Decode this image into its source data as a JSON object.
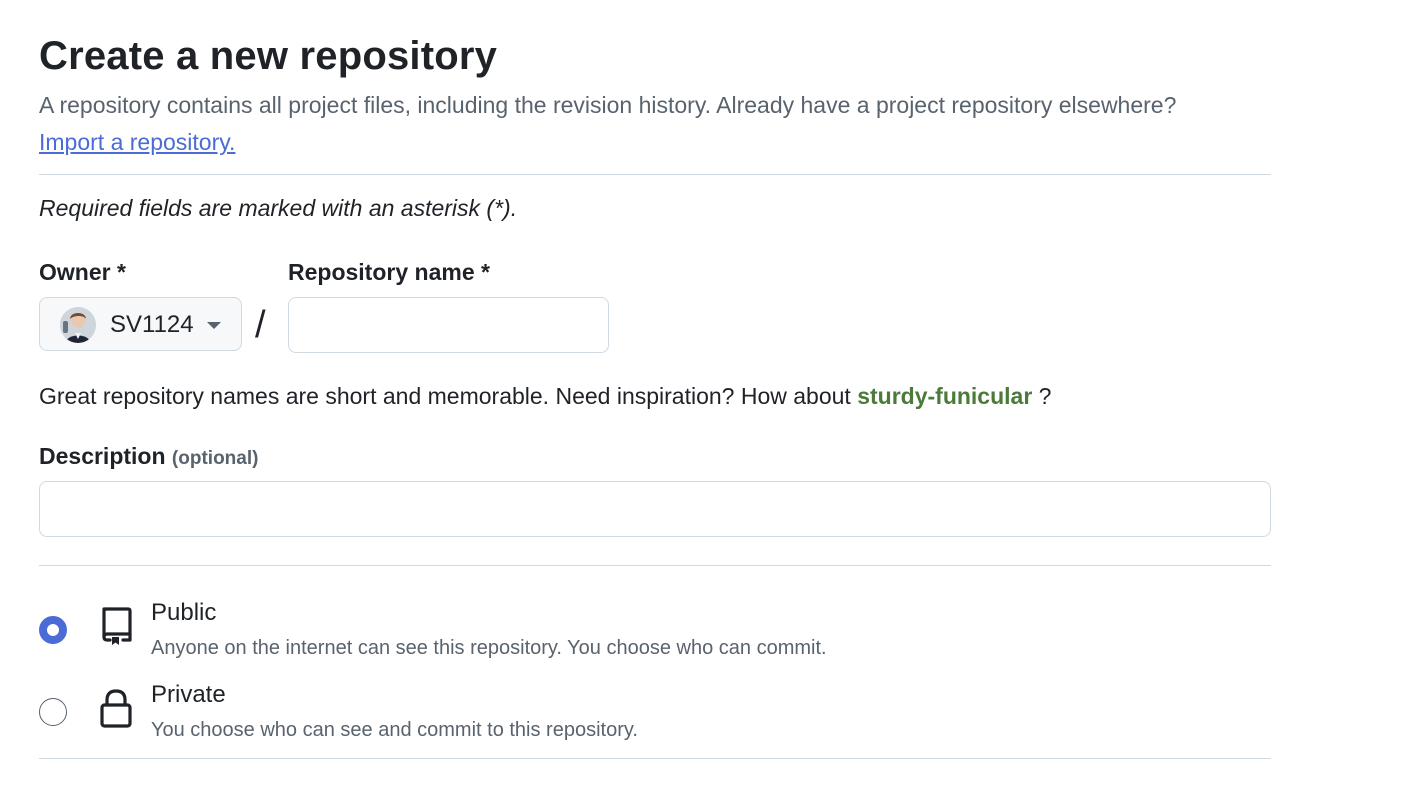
{
  "header": {
    "title": "Create a new repository",
    "subtitle": "A repository contains all project files, including the revision history. Already have a project repository elsewhere?",
    "import_link": "Import a repository."
  },
  "form": {
    "required_note": "Required fields are marked with an asterisk (*).",
    "owner": {
      "label": "Owner *",
      "value": "SV1124"
    },
    "separator": "/",
    "repo_name": {
      "label": "Repository name *",
      "value": "",
      "placeholder": ""
    },
    "name_help": {
      "prefix": "Great repository names are short and memorable. Need inspiration? How about",
      "suggestion": "sturdy-funicular",
      "suffix": "?"
    },
    "description": {
      "label": "Description",
      "optional_tag": "(optional)",
      "value": "",
      "placeholder": ""
    }
  },
  "visibility": {
    "selected": "public",
    "options": [
      {
        "id": "public",
        "title": "Public",
        "description": "Anyone on the internet can see this repository. You choose who can commit.",
        "icon": "repo-icon"
      },
      {
        "id": "private",
        "title": "Private",
        "description": "You choose who can see and commit to this repository.",
        "icon": "lock-icon"
      }
    ]
  },
  "colors": {
    "accent": "#4b6bd6",
    "suggestion": "#4b7a3a",
    "muted_text": "#59636e",
    "border": "#d1d9e0"
  }
}
